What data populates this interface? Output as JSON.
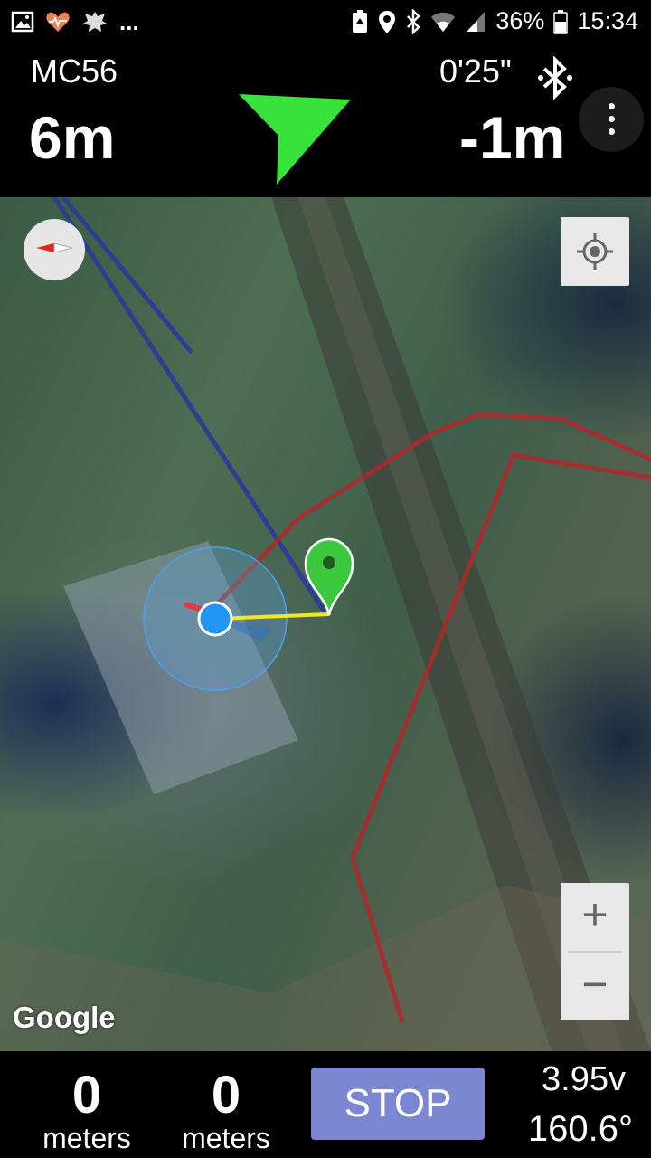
{
  "status_bar": {
    "icons_left": [
      "image-icon",
      "heart-rate-icon",
      "emblem-icon",
      "more-notifications-icon"
    ],
    "overflow": "...",
    "icons_right": [
      "battery-saver-icon",
      "location-icon",
      "bluetooth-icon",
      "wifi-icon",
      "signal-icon"
    ],
    "battery": "36%",
    "time": "15:34"
  },
  "header": {
    "route_name": "MC56",
    "distance_left": "6m",
    "timer": "0'25\"",
    "distance_right": "-1m",
    "arrow_color": "#37e23a"
  },
  "map": {
    "attribution": "Google",
    "zoom_in": "+",
    "zoom_out": "−"
  },
  "footer": {
    "stat1_value": "0",
    "stat1_unit": "meters",
    "stat2_value": "0",
    "stat2_unit": "meters",
    "stop_label": "STOP",
    "voltage": "3.95v",
    "heading": "160.6°"
  },
  "colors": {
    "stop_button": "#7c87d3",
    "track_red": "#b0282a",
    "track_blue": "#2a3a9a",
    "position_blue": "#2196f3",
    "marker_green": "#3cc83c"
  }
}
